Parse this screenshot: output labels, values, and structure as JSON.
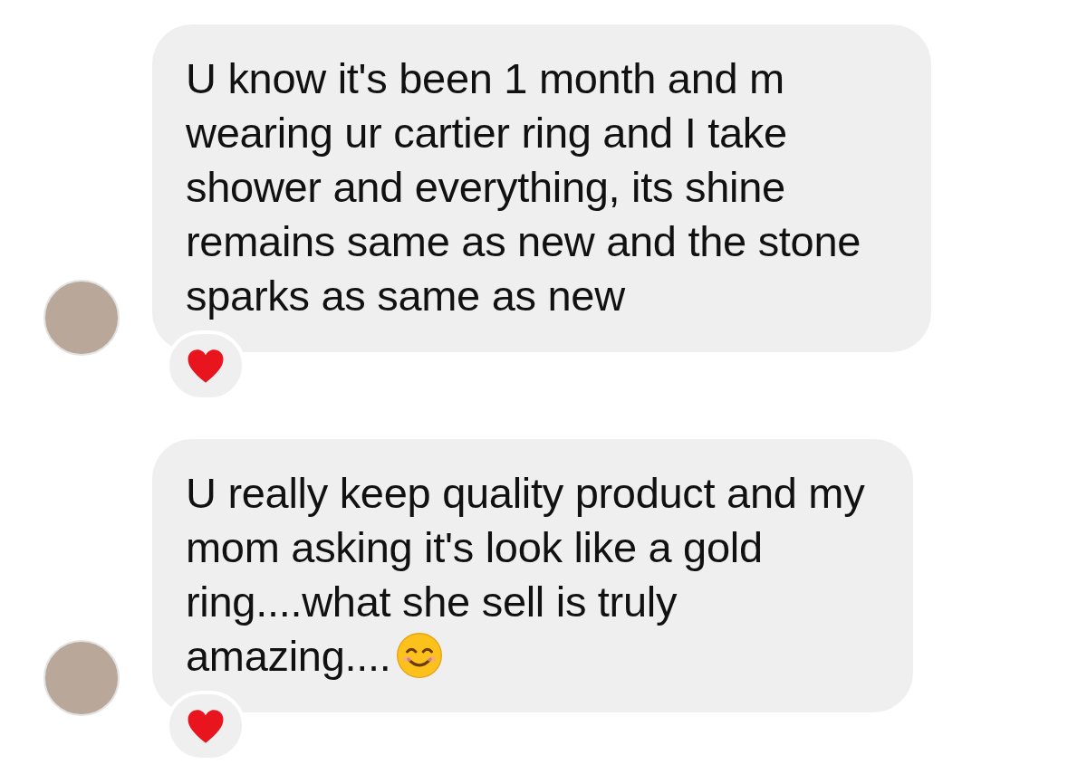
{
  "messages": [
    {
      "text": "U know it's been 1 month and m wearing ur cartier ring and I take shower and everything, its shine remains same as new and the stone sparks as same as new",
      "reaction": {
        "kind": "heart"
      }
    },
    {
      "text": "U really keep quality product and my mom asking it's look like a gold ring....what she sell is truly amazing....",
      "end_emoji": {
        "kind": "smile"
      },
      "reaction": {
        "kind": "heart"
      }
    }
  ]
}
